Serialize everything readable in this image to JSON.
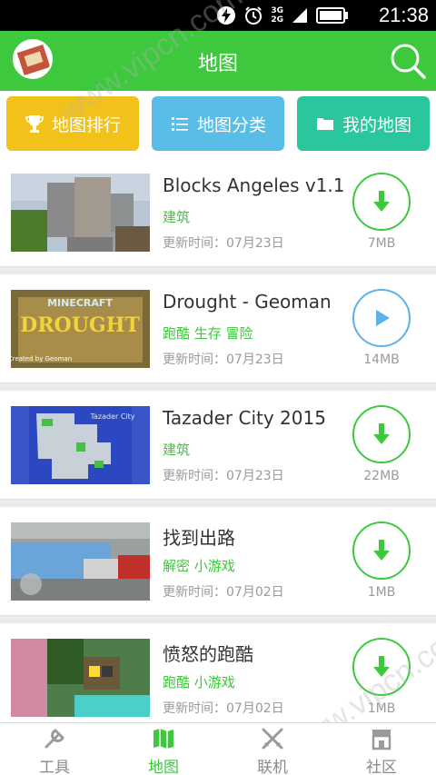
{
  "status_bar": {
    "network": [
      "3G",
      "2G"
    ],
    "time": "21:38"
  },
  "header": {
    "title": "地图"
  },
  "categories": [
    {
      "label": "地图排行",
      "color": "#f2c21b",
      "icon": "trophy-icon"
    },
    {
      "label": "地图分类",
      "color": "#59bde8",
      "icon": "list-icon"
    },
    {
      "label": "我的地图",
      "color": "#2ac79e",
      "icon": "folder-icon"
    }
  ],
  "maps": [
    {
      "name": "Blocks Angeles v1.1",
      "tags": "建筑",
      "date": "更新时间：07月23日",
      "size": "7MB",
      "action": "download"
    },
    {
      "name": "Drought - Geoman",
      "tags": "跑酷 生存 冒险",
      "date": "更新时间：07月23日",
      "size": "14MB",
      "action": "play"
    },
    {
      "name": "Tazader City 2015",
      "tags": "建筑",
      "date": "更新时间：07月23日",
      "size": "22MB",
      "action": "download"
    },
    {
      "name": "找到出路",
      "tags": "解密 小游戏",
      "date": "更新时间：07月02日",
      "size": "1MB",
      "action": "download"
    },
    {
      "name": "愤怒的跑酷",
      "tags": "跑酷 小游戏",
      "date": "更新时间：07月02日",
      "size": "1MB",
      "action": "download"
    }
  ],
  "thumb_text": {
    "drought_brand": "MINECRAFT",
    "drought_title": "DROUGHT",
    "drought_credit": "Created by Geoman",
    "tazader": "Tazader City"
  },
  "tabs": [
    {
      "label": "工具",
      "icon": "wrench-icon",
      "active": false
    },
    {
      "label": "地图",
      "icon": "map-icon",
      "active": true
    },
    {
      "label": "联机",
      "icon": "crossed-swords-icon",
      "active": false
    },
    {
      "label": "社区",
      "icon": "shop-icon",
      "active": false
    }
  ],
  "watermark": "www.vipcn.com",
  "colors": {
    "primary": "#3dc83d",
    "play": "#5ab2e8",
    "status_bg": "#000000"
  }
}
